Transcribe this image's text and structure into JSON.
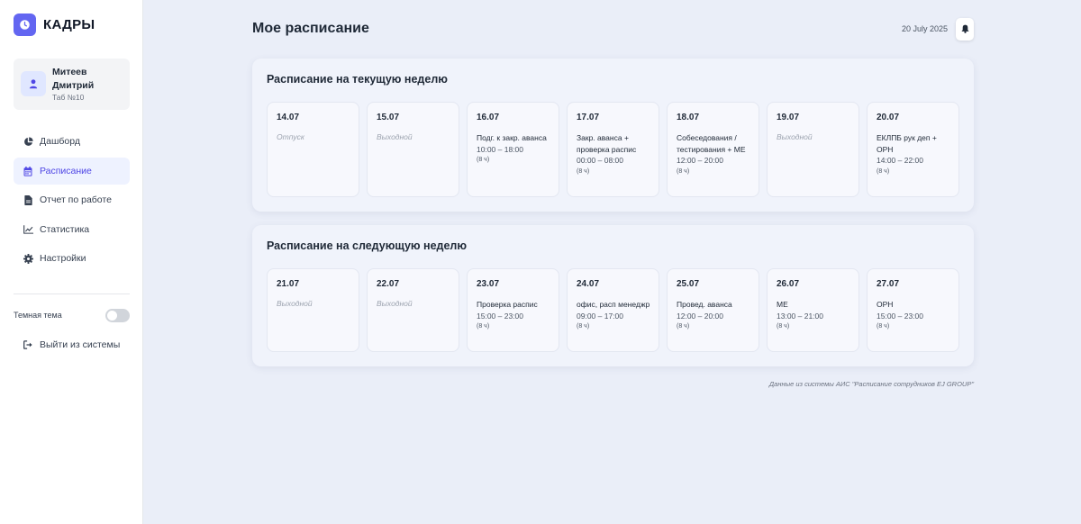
{
  "sidebar": {
    "logo_text": "КАДРЫ",
    "user": {
      "name": "Митеев Дмитрий",
      "tab": "Таб №10"
    },
    "nav": [
      {
        "label": "Дашборд",
        "icon": "pie-chart-icon",
        "active": false
      },
      {
        "label": "Расписание",
        "icon": "calendar-icon",
        "active": true
      },
      {
        "label": "Отчет по работе",
        "icon": "document-icon",
        "active": false
      },
      {
        "label": "Статистика",
        "icon": "line-chart-icon",
        "active": false
      },
      {
        "label": "Настройки",
        "icon": "gear-icon",
        "active": false
      }
    ],
    "dark_theme_label": "Темная тема",
    "dark_theme_on": false,
    "logout_label": "Выйти из системы"
  },
  "header": {
    "title": "Мое расписание",
    "date": "20 July 2025"
  },
  "current_week": {
    "title": "Расписание на текущую неделю",
    "days": [
      {
        "date": "14.07",
        "status": "Отпуск"
      },
      {
        "date": "15.07",
        "status": "Выходной"
      },
      {
        "date": "16.07",
        "shift": "Подг. к закр. аванса",
        "time": "10:00 – 18:00",
        "hours": "(8 ч)"
      },
      {
        "date": "17.07",
        "shift": "Закр. аванса + проверка распис",
        "time": "00:00 – 08:00",
        "hours": "(8 ч)"
      },
      {
        "date": "18.07",
        "shift": "Собеседования / тестирования + МЕ",
        "time": "12:00 – 20:00",
        "hours": "(8 ч)"
      },
      {
        "date": "19.07",
        "status": "Выходной"
      },
      {
        "date": "20.07",
        "shift": "ЕКЛПБ рук деп + ОРН",
        "time": "14:00 – 22:00",
        "hours": "(8 ч)"
      }
    ]
  },
  "next_week": {
    "title": "Расписание на следующую неделю",
    "days": [
      {
        "date": "21.07",
        "status": "Выходной"
      },
      {
        "date": "22.07",
        "status": "Выходной"
      },
      {
        "date": "23.07",
        "shift": "Проверка распис",
        "time": "15:00 – 23:00",
        "hours": "(8 ч)"
      },
      {
        "date": "24.07",
        "shift": "офис, расп менеджр",
        "time": "09:00 – 17:00",
        "hours": "(8 ч)"
      },
      {
        "date": "25.07",
        "shift": "Провед. аванса",
        "time": "12:00 – 20:00",
        "hours": "(8 ч)"
      },
      {
        "date": "26.07",
        "shift": "МЕ",
        "time": "13:00 – 21:00",
        "hours": "(8 ч)"
      },
      {
        "date": "27.07",
        "shift": "ОРН",
        "time": "15:00 – 23:00",
        "hours": "(8 ч)"
      }
    ]
  },
  "footer_note": "Данные из системы АИС \"Расписание сотрудников EJ GROUP\"",
  "colors": {
    "accent": "#6366f1",
    "active_nav_bg": "#eef2ff",
    "background": "#eaeef8"
  }
}
